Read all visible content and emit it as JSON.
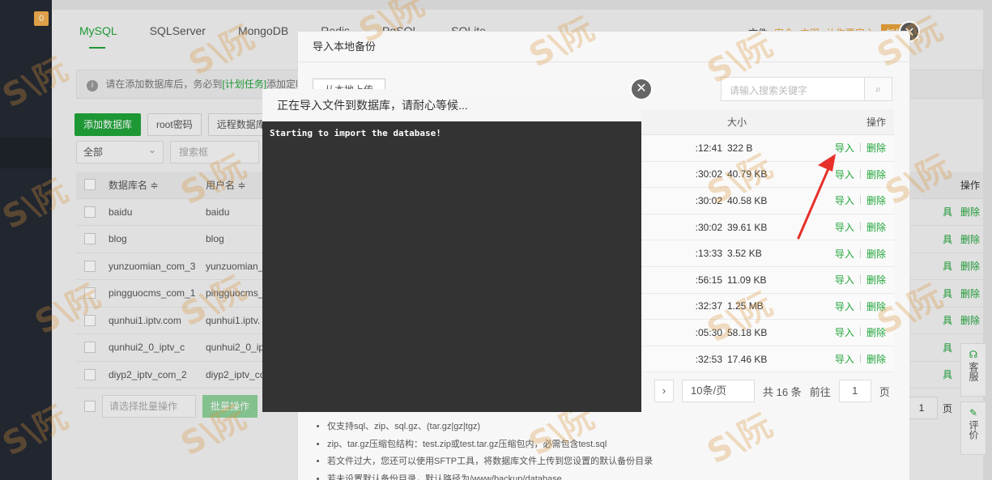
{
  "sidebar": {
    "badge": "0"
  },
  "tabs": [
    "MySQL",
    "SQLServer",
    "MongoDB",
    "Redis",
    "PgSQL",
    "SQLite"
  ],
  "top_right": {
    "a": "文件",
    "b": "安全",
    "c": "立即",
    "d": "让你更安心",
    "pill": "加体验"
  },
  "notice": {
    "text": "请在添加数据库后，务必到",
    "link": "[计划任务]",
    "tail": "添加定时"
  },
  "buttons": {
    "add_db": "添加数据库",
    "root_pwd": "root密码",
    "remote_db": "远程数据库"
  },
  "filter": {
    "scope": "全部",
    "search_placeholder": "搜索框"
  },
  "db_table": {
    "col_name": "数据库名 ≑",
    "col_user": "用户名 ≑",
    "col_ops": "操作",
    "rows": [
      {
        "name": "baidu",
        "user": "baidu"
      },
      {
        "name": "blog",
        "user": "blog"
      },
      {
        "name": "yunzuomian_com_3",
        "user": "yunzuomian_"
      },
      {
        "name": "pingguocms_com_1",
        "user": "pingguocms_"
      },
      {
        "name": "qunhui1.iptv.com",
        "user": "qunhui1.iptv."
      },
      {
        "name": "qunhui2_0_iptv_c",
        "user": "qunhui2_0_ipt"
      },
      {
        "name": "diyp2_iptv_com_2",
        "user": "diyp2_iptv_co"
      }
    ],
    "op_a": "具",
    "op_del": "删除"
  },
  "batch": {
    "placeholder": "请选择批量操作",
    "button": "批量操作"
  },
  "page_right": {
    "page": "1",
    "unit": "页"
  },
  "float_tools": {
    "service": "客服",
    "rate": "评价"
  },
  "backup_dialog": {
    "title": "导入本地备份",
    "upload": "从本地上传",
    "search_placeholder": "请输入搜索关键字",
    "col_size": "大小",
    "col_ops": "操作",
    "rows": [
      {
        "time": ":12:41",
        "size": "322 B"
      },
      {
        "time": ":30:02",
        "size": "40.79 KB"
      },
      {
        "time": ":30:02",
        "size": "40.58 KB"
      },
      {
        "time": ":30:02",
        "size": "39.61 KB"
      },
      {
        "time": ":13:33",
        "size": "3.52 KB"
      },
      {
        "time": ":56:15",
        "size": "11.09 KB"
      },
      {
        "time": ":32:37",
        "size": "1.25 MB"
      },
      {
        "time": ":05:30",
        "size": "58.18 KB"
      },
      {
        "time": ":32:53",
        "size": "17.46 KB"
      }
    ],
    "op_import": "导入",
    "op_delete": "删除",
    "pager": {
      "page_size": "10条/页",
      "total": "共 16 条",
      "goto": "前往",
      "page": "1",
      "unit": "页"
    },
    "tips": [
      "仅支持sql、zip、sql.gz、(tar.gz|gz|tgz)",
      "zip、tar.gz压缩包结构：test.zip或test.tar.gz压缩包内，必需包含test.sql",
      "若文件过大，您还可以使用SFTP工具，将数据库文件上传到您设置的默认备份目录",
      "若未设置默认备份目录，默认路径为/www/backup/database"
    ]
  },
  "import_modal": {
    "title": "正在导入文件到数据库，请耐心等候...",
    "log": "Starting to import the database!"
  },
  "watermark": "S\\阮",
  "colors": {
    "accent": "#20a53a",
    "warning": "#e6a23c",
    "arrow": "#e8302a"
  }
}
